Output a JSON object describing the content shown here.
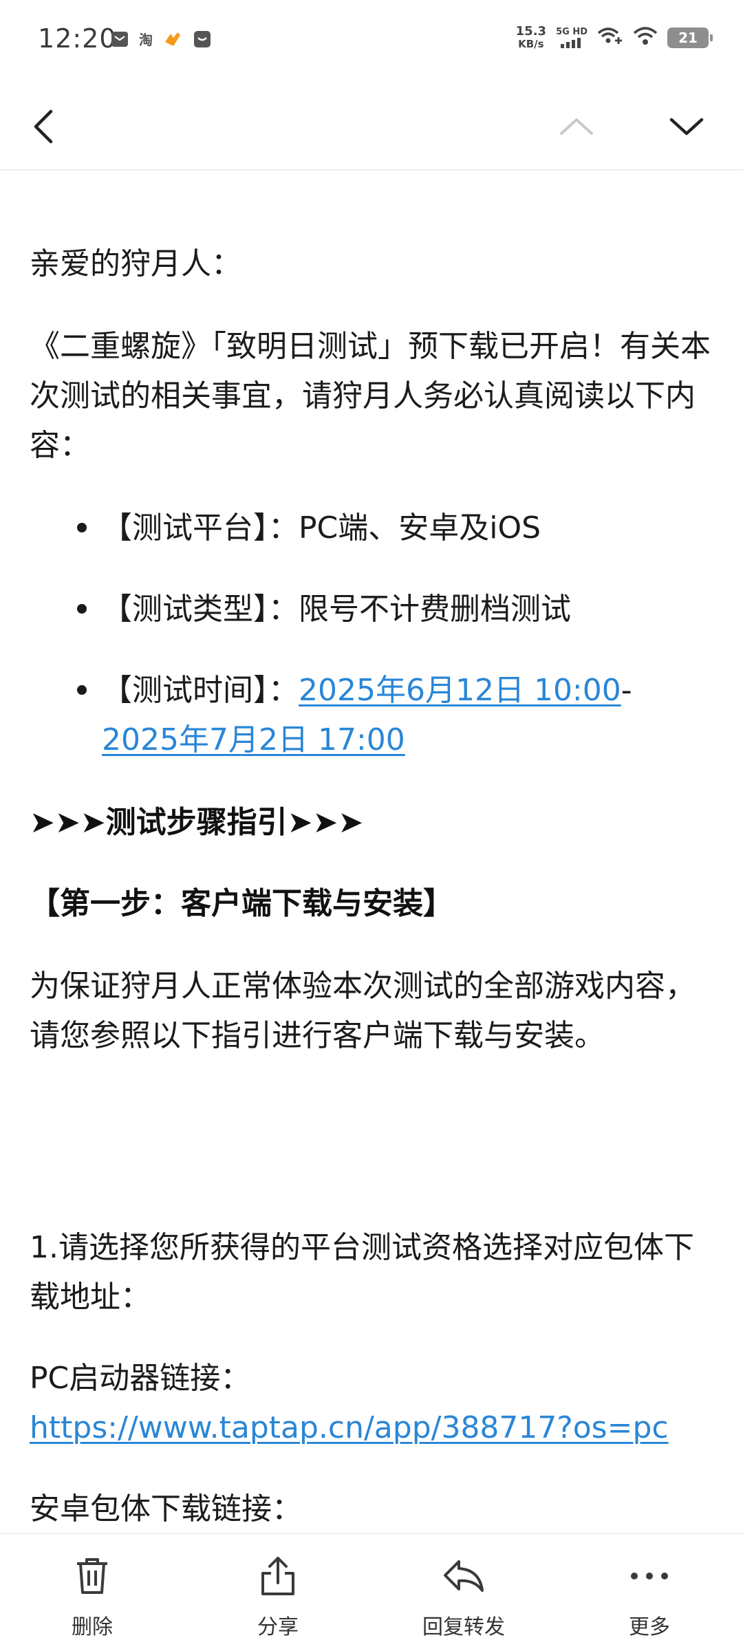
{
  "status_bar": {
    "time": "12:20",
    "net_speed_value": "15.3",
    "net_speed_unit": "KB/s",
    "signal_label": "5G HD",
    "battery": "21",
    "taobao_glyph": "淘"
  },
  "nav": {
    "back_icon": "chevron-left-icon",
    "prev_icon": "chevron-up-icon",
    "next_icon": "chevron-down-icon"
  },
  "email": {
    "greeting": "亲爱的狩月人：",
    "intro": "《二重螺旋》「致明日测试」预下载已开启！有关本次测试的相关事宜，请狩月人务必认真阅读以下内容：",
    "bullets": {
      "platform": "【测试平台】：PC端、安卓及iOS",
      "type": "【测试类型】：限号不计费删档测试",
      "time_label": "【测试时间】：",
      "time_start": "2025年6月12日 10:00",
      "time_sep": "-",
      "time_end": "2025年7月2日 17:00"
    },
    "steps_heading": "➤➤➤测试步骤指引➤➤➤",
    "step1_heading": "【第一步：客户端下载与安装】",
    "step1_desc": "为保证狩月人正常体验本次测试的全部游戏内容，请您参照以下指引进行客户端下载与安装。",
    "item1": "1.请选择您所获得的平台测试资格选择对应包体下载地址：",
    "pc_label": "PC启动器链接：",
    "pc_url": "https://www.taptap.cn/app/388717?os=pc",
    "android_label": "安卓包体下载链接："
  },
  "toolbar": {
    "delete_label": "删除",
    "share_label": "分享",
    "reply_label": "回复转发",
    "more_label": "更多"
  },
  "colors": {
    "link": "#2a86d6",
    "text": "#1b1b1b",
    "icon": "#3a3a3a"
  }
}
